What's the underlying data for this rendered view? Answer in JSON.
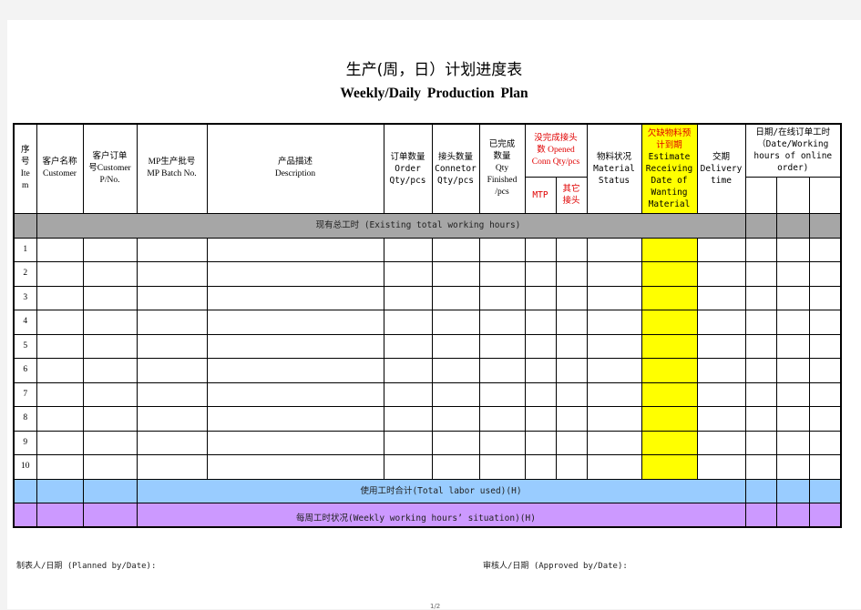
{
  "document": {
    "title_cn": "生产(周，日）计划进度表",
    "title_en": "Weekly/Daily  Production  Plan",
    "page_number": "1/2"
  },
  "table": {
    "headers": {
      "item": "序号Item",
      "customer": "客户名称Customer",
      "customer_po": "客户订单号Customer P/No.",
      "mp_batch": "MP生产批号 MP Batch No.",
      "description": "产品描述 Description",
      "order_qty": "订单数量 Order Qty/pcs",
      "connector_qty": "接头数量 Connetor Qty/pcs",
      "finished_qty": "已完成数量 Qty Finished /pcs",
      "opened_conn_qty": "没完成接头数 Opened Conn Qty/pcs",
      "mtp": "MTP",
      "other_connector": "其它接头",
      "material_status": "物料状况 Material Status",
      "estimate_receiving": "欠缺物料预计到期 Estimate Receiving Date of Wanting Material",
      "delivery_time": "交期 Delivery time",
      "date_working_hours": "日期/在线订单工时（Date/Working hours of online order)"
    },
    "header_lines": {
      "item": [
        "序",
        "号",
        "Ite",
        "m"
      ],
      "customer": [
        "客户名称",
        "Customer"
      ],
      "customer_po": [
        "客户订单",
        "号Customer",
        "P/No."
      ],
      "mp_batch": [
        "MP生产批号",
        "MP Batch No."
      ],
      "description": [
        "产品描述",
        "Description"
      ],
      "order_qty": [
        "订单数量",
        "Order",
        "Qty/pcs"
      ],
      "connector_qty": [
        "接头数量",
        "Connetor",
        "Qty/pcs"
      ],
      "finished_qty": [
        "已完成",
        "数量",
        "Qty",
        "Finished",
        "/pcs"
      ],
      "opened_conn_qty": [
        "没完成接头",
        "数 Opened",
        "Conn Qty/pcs"
      ],
      "mtp": [
        "MTP"
      ],
      "other_connector": [
        "其它",
        "接头"
      ],
      "material_status": [
        "物料状况",
        "Material",
        "Status"
      ],
      "estimate_receiving": [
        "欠缺物料预",
        "计到期",
        "Estimate",
        "Receiving",
        "Date of",
        "Wanting",
        "Material"
      ],
      "delivery_time": [
        "交期",
        "Delivery",
        "time"
      ],
      "date_working_hours": [
        "日期/在线订单工时",
        "（Date/Working",
        "hours of online",
        "order)"
      ]
    },
    "existing_hours_label": "现有总工时 (Existing total working hours)",
    "rows": [
      {
        "item": "1"
      },
      {
        "item": "2"
      },
      {
        "item": "3"
      },
      {
        "item": "4"
      },
      {
        "item": "5"
      },
      {
        "item": "6"
      },
      {
        "item": "7"
      },
      {
        "item": "8"
      },
      {
        "item": "9"
      },
      {
        "item": "10"
      }
    ],
    "total_labor_label": "使用工时合计(Total labor used)(H)",
    "weekly_hours_label": "每周工时状况(Weekly working hours’ situation)(H)"
  },
  "footer": {
    "planned_by": "制表人/日期 (Planned by/Date):",
    "approved_by": "审核人/日期 (Approved by/Date):"
  },
  "colors": {
    "highlight_yellow": "#ffff00",
    "existing_hours_gray": "#a6a6a6",
    "total_labor_blue": "#99ccff",
    "weekly_hours_purple": "#cc99ff",
    "red_header_text": "#e00000"
  }
}
